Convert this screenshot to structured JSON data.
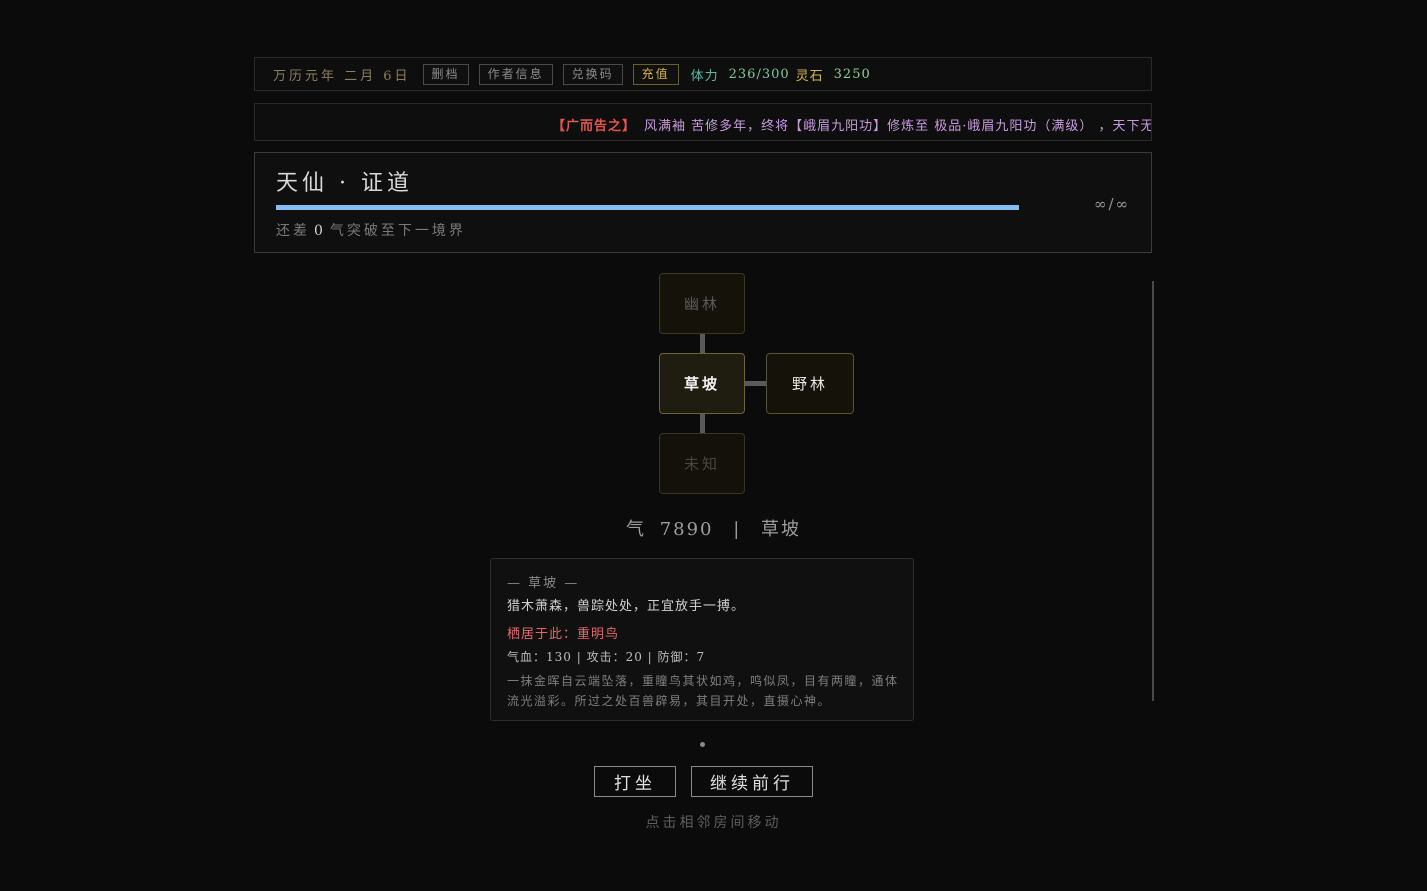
{
  "topbar": {
    "date": "万历元年 二月 6日",
    "buttons": [
      "删档",
      "作者信息",
      "兑换码",
      "充值"
    ],
    "stamina_label": "体力",
    "stamina_value": "236/300",
    "stone_label": "灵石",
    "stone_value": "3250"
  },
  "ticker": {
    "tag": "【广而告之】",
    "text": "风满袖 苦修多年，终将【峨眉九阳功】修炼至 极品·峨眉九阳功（满级） ，天下无"
  },
  "realm": {
    "title": "天仙 · 证道",
    "progress_text": "∞/∞",
    "progress_fraction": 1.0,
    "note_prefix": "还差",
    "note_value": "0",
    "note_suffix": "气突破至下一境界"
  },
  "map": {
    "north": "幽林",
    "current": "草坡",
    "east": "野林",
    "south": "未知"
  },
  "status": {
    "qi_label": "气",
    "qi_value": "7890",
    "separator": "|",
    "location": "草坡"
  },
  "card": {
    "head": "— 草坡 —",
    "desc": "猎木萧森，兽踪处处，正宜放手一搏。",
    "monster_label": "栖居于此：",
    "monster_name": "重明鸟",
    "stats": "气血：130 | 攻击：20 | 防御：7",
    "lore": "一抹金晖自云端坠落，重瞳鸟其状如鸡，鸣似凤，目有两瞳，通体流光溢彩。所过之处百兽辟易，其目开处，直摄心神。"
  },
  "actions": {
    "meditate": "打坐",
    "continue": "继续前行"
  },
  "hint": "点击相邻房间移动"
}
